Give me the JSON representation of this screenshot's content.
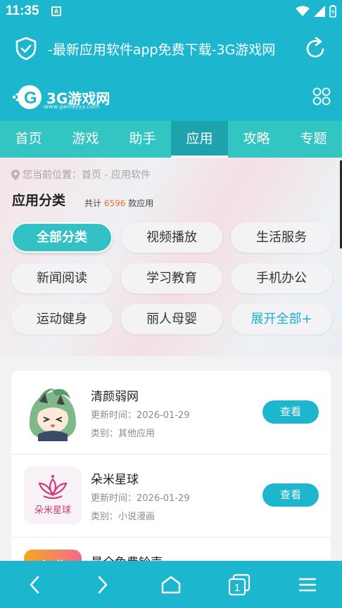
{
  "status": {
    "time": "11:35",
    "notif_glyph": "A"
  },
  "browser": {
    "page_title": "-最新应用软件app免费下载-3G游戏网"
  },
  "site": {
    "brand": "3G游戏网",
    "tagline": "-www.gameyyy.com-",
    "logo_mark": "G"
  },
  "nav": {
    "items": [
      "首页",
      "游戏",
      "助手",
      "应用",
      "攻略",
      "专题"
    ],
    "active": "应用"
  },
  "breadcrumb": {
    "text": "您当前位置：首页 - 应用软件"
  },
  "category": {
    "title": "应用分类",
    "count_prefix": "共计",
    "count": "6596",
    "count_suffix": "款应用",
    "chips": [
      "全部分类",
      "视频播放",
      "生活服务",
      "新闻阅读",
      "学习教育",
      "手机办公",
      "运动健身",
      "丽人母婴",
      "展开全部+"
    ],
    "active_chip": "全部分类"
  },
  "apps": [
    {
      "name": "清颜弱网",
      "updated": "更新时间：2026-01-29",
      "category": "类别：其他应用",
      "button": "查看"
    },
    {
      "name": "朵米星球",
      "updated": "更新时间：2026-01-29",
      "category": "类别：小说漫画",
      "button": "查看",
      "logo_text": "朵米星球"
    },
    {
      "name": "最全免费铃声",
      "logo_text": "免费"
    }
  ],
  "bottom_nav": {
    "tab_count": "1",
    "icons": [
      "back-icon",
      "forward-icon",
      "home-icon",
      "tabs-icon",
      "menu-icon"
    ]
  },
  "colors": {
    "primary": "#1cb7cf",
    "nav": "#33c5c1",
    "nav_active": "#1ea2ac",
    "accent_orange": "#f26c3a"
  }
}
